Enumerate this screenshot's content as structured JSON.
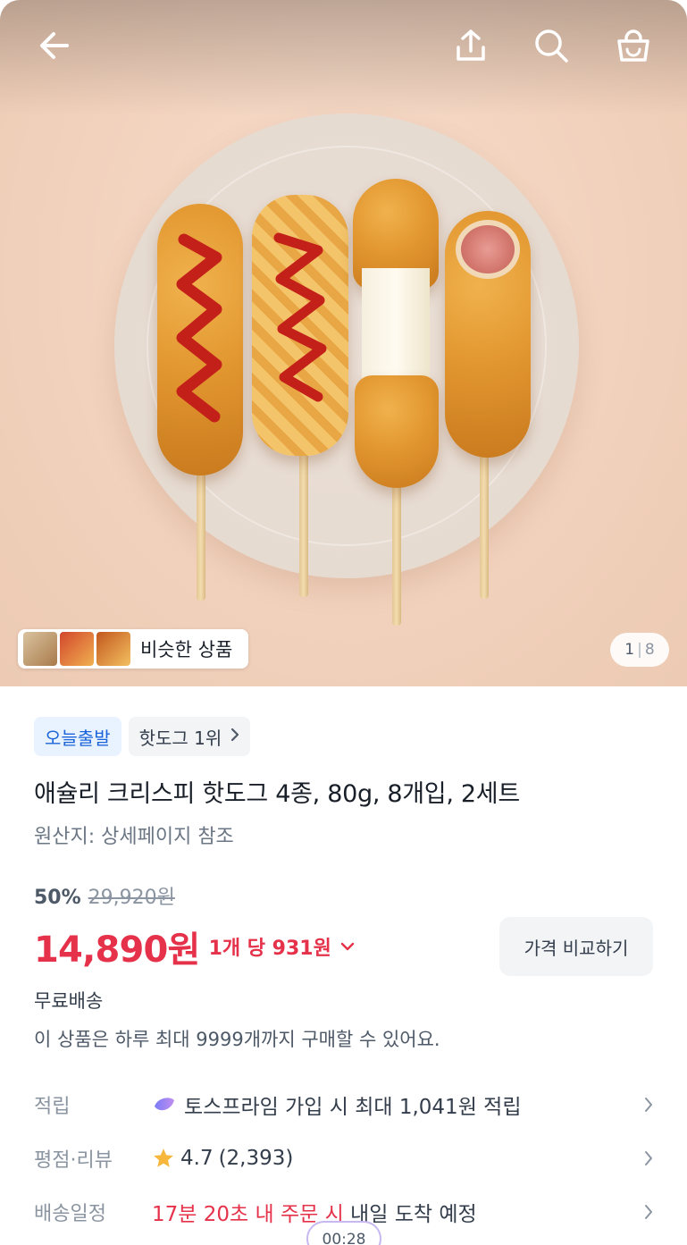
{
  "header": {
    "back_icon": "arrow-left-icon",
    "share_icon": "share-upload-icon",
    "search_icon": "search-icon",
    "cart_icon": "shopping-bag-icon"
  },
  "gallery": {
    "image_description_icon": "corn-dog-product-photo",
    "similar_label": "비슷한 상품",
    "page_current": "1",
    "page_total": "8"
  },
  "tags": [
    {
      "label": "오늘출발"
    },
    {
      "label": "핫도그 1위"
    }
  ],
  "product": {
    "title": "애슐리 크리스피 핫도그 4종, 80g, 8개입, 2세트",
    "origin": "원산지: 상세페이지 참조",
    "discount": "50%",
    "original_price": "29,920원",
    "price": "14,890원",
    "unit_price": "1개 당 931원",
    "compare_label": "가격 비교하기",
    "shipping": "무료배송",
    "limit": "이 상품은 하루 최대 9999개까지 구매할 수 있어요."
  },
  "info_rows": [
    {
      "label": "적립",
      "value": "토스프라임 가입 시 최대 1,041원 적립",
      "icon": "toss-prime-icon"
    },
    {
      "label": "평점·리뷰",
      "rating": "4.7",
      "reviews": "(2,393)",
      "icon": "star-icon"
    },
    {
      "label": "배송일정",
      "value_red": "17분 20초 내 주문 시",
      "value": " 내일 도착 예정"
    }
  ],
  "timer": "00:28",
  "colors": {
    "accent_red": "#e5324a",
    "tag_blue": "#1b64da",
    "tag_blue_bg": "#e8f3ff",
    "star": "#f6b73c"
  }
}
